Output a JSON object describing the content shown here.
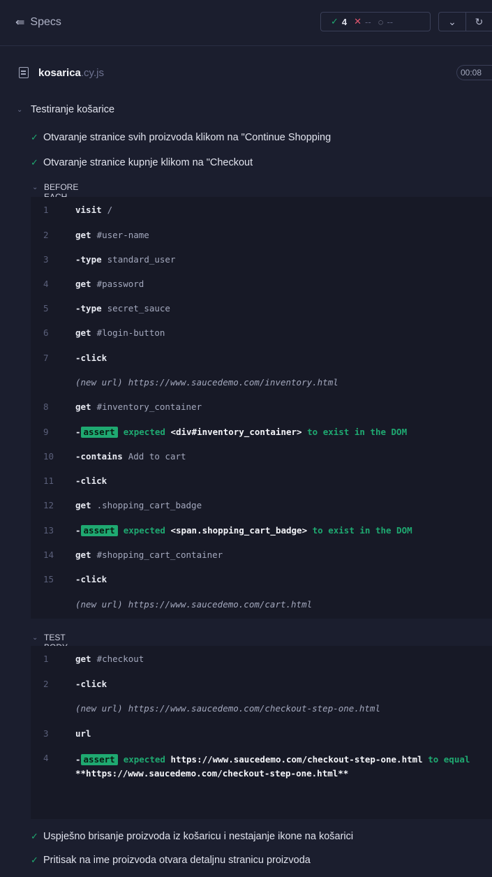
{
  "header": {
    "specs_label": "Specs",
    "stats": {
      "passed": "4",
      "failed": "--",
      "pending": "--"
    }
  },
  "file": {
    "name": "kosarica",
    "ext": ".cy.js",
    "duration": "00:08"
  },
  "suite": {
    "title": "Testiranje košarice",
    "tests_before": [
      "Otvaranje stranice svih proizvoda klikom na \"Continue Shopping",
      "Otvaranje stranice kupnje klikom na \"Checkout"
    ],
    "before_each_label": "BEFORE EACH",
    "test_body_label": "TEST BODY",
    "tests_after": [
      "Uspješno brisanje proizvoda iz košaricu i nestajanje ikone na košarici",
      "Pritisak na ime proizvoda otvara detaljnu stranicu proizvoda"
    ]
  },
  "before_each": [
    {
      "n": "1",
      "name": "visit",
      "msg": "/"
    },
    {
      "n": "2",
      "name": "get",
      "msg": "#user-name"
    },
    {
      "n": "3",
      "name": "-type",
      "msg": "standard_user"
    },
    {
      "n": "4",
      "name": "get",
      "msg": "#password"
    },
    {
      "n": "5",
      "name": "-type",
      "msg": "secret_sauce"
    },
    {
      "n": "6",
      "name": "get",
      "msg": "#login-button"
    },
    {
      "n": "7",
      "name": "-click",
      "msg": ""
    },
    {
      "newurl_label": "(new url)",
      "url": "https://www.saucedemo.com/inventory.html"
    },
    {
      "n": "8",
      "name": "get",
      "msg": "#inventory_container"
    },
    {
      "n": "9",
      "assert": "assert",
      "a1": "expected",
      "a2": "<div#inventory_container>",
      "a3": "to exist in the DOM"
    },
    {
      "n": "10",
      "name": "-contains",
      "msg": "Add to cart"
    },
    {
      "n": "11",
      "name": "-click",
      "msg": ""
    },
    {
      "n": "12",
      "name": "get",
      "msg": ".shopping_cart_badge"
    },
    {
      "n": "13",
      "assert": "assert",
      "a1": "expected",
      "a2": "<span.shopping_cart_badge>",
      "a3": "to exist in the DOM"
    },
    {
      "n": "14",
      "name": "get",
      "msg": "#shopping_cart_container"
    },
    {
      "n": "15",
      "name": "-click",
      "msg": ""
    },
    {
      "newurl_label": "(new url)",
      "url": "https://www.saucedemo.com/cart.html"
    }
  ],
  "test_body": [
    {
      "n": "1",
      "name": "get",
      "msg": "#checkout"
    },
    {
      "n": "2",
      "name": "-click",
      "msg": ""
    },
    {
      "newurl_label": "(new url)",
      "url": "https://www.saucedemo.com/checkout-step-one.html"
    },
    {
      "n": "3",
      "name": "url",
      "msg": ""
    },
    {
      "n": "4",
      "assert": "assert",
      "a1": "expected",
      "a2": "https://www.saucedemo.com/checkout-step-one.html",
      "a3": "to equal",
      "a4": "**https://www.saucedemo.com/checkout-step-one.html**"
    }
  ],
  "colors": {
    "pass": "#1fa971",
    "fail": "#e45770",
    "bg": "#1b1e2e",
    "panel": "#171926"
  }
}
